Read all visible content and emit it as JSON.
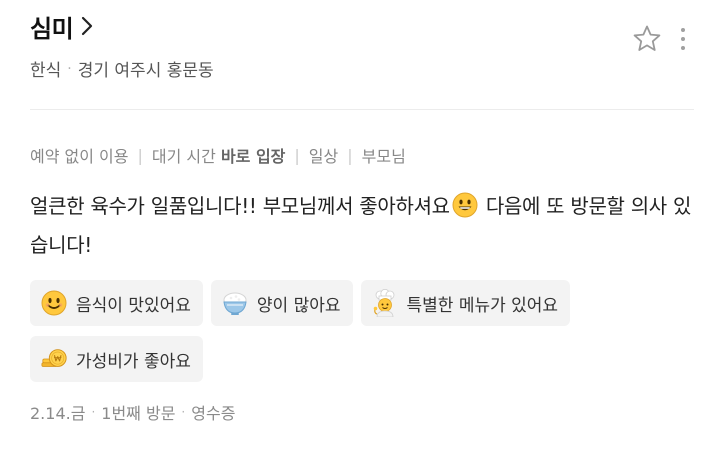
{
  "place": {
    "name": "심미",
    "category": "한식",
    "location": "경기 여주시 홍문동"
  },
  "tags": {
    "reservation": "예약 없이 이용",
    "wait_prefix": "대기 시간 ",
    "wait_value": "바로 입장",
    "occasion": "일상",
    "companion": "부모님"
  },
  "review": {
    "text_part1": "얼큰한 육수가 일품입니다!! 부모님께서 좋아하셔요",
    "text_part2": " 다음에 또 방문할 의사 있습니다!"
  },
  "keywords": [
    {
      "label": "음식이 맛있어요",
      "icon": "smiling-face-icon"
    },
    {
      "label": "양이 많아요",
      "icon": "rice-bowl-icon"
    },
    {
      "label": "특별한 메뉴가 있어요",
      "icon": "chef-icon"
    },
    {
      "label": "가성비가 좋아요",
      "icon": "coins-icon"
    }
  ],
  "footer": {
    "date": "2.14.금",
    "visit": "1번째 방문",
    "verification": "영수증"
  },
  "colors": {
    "emoji_yellow": "#FFC83D",
    "chip_bg": "#F3F3F3",
    "divider": "#ECECEC"
  }
}
